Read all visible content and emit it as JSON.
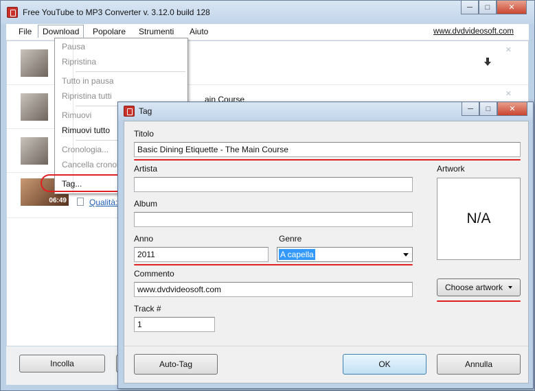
{
  "app": {
    "title": "Free YouTube to MP3 Converter  v. 3.12.0 build 128"
  },
  "menubar": {
    "items": [
      "File",
      "Download",
      "Popolare",
      "Strumenti",
      "Aiuto"
    ],
    "site_link": "www.dvdvideosoft.com"
  },
  "download_menu": {
    "items": [
      {
        "label": "Pausa",
        "enabled": false
      },
      {
        "label": "Ripristina",
        "enabled": false
      },
      {
        "label": "Tutto in pausa",
        "enabled": false
      },
      {
        "label": "Ripristina tutti",
        "enabled": false
      },
      {
        "label": "Rimuovi",
        "enabled": false
      },
      {
        "label": "Rimuovi tutto",
        "enabled": true
      },
      {
        "label": "Cronologia...",
        "enabled": false
      },
      {
        "label": "Cancella cronol",
        "enabled": false
      },
      {
        "label": "Tag...",
        "enabled": true
      }
    ]
  },
  "list": {
    "row2_title_fragment": "ain Course",
    "row4_duration": "06:49",
    "row4_quality_label": "Qualità:"
  },
  "bottom": {
    "paste_label": "Incolla"
  },
  "tag_dialog": {
    "title": "Tag",
    "fields": {
      "titolo": {
        "label": "Titolo",
        "value": "Basic Dining Etiquette - The Main Course"
      },
      "artista": {
        "label": "Artista",
        "value": ""
      },
      "album": {
        "label": "Album",
        "value": ""
      },
      "anno": {
        "label": "Anno",
        "value": "2011"
      },
      "genre": {
        "label": "Genre",
        "value": "A capella"
      },
      "commento": {
        "label": "Commento",
        "value": "www.dvdvideosoft.com"
      },
      "track": {
        "label": "Track #",
        "value": "1"
      }
    },
    "artwork": {
      "label": "Artwork",
      "placeholder": "N/A",
      "choose_label": "Choose artwork"
    },
    "buttons": {
      "autotag": "Auto-Tag",
      "ok": "OK",
      "cancel": "Annulla"
    }
  },
  "colors": {
    "highlight_red": "#e02020",
    "selection_blue": "#3399ff",
    "link_blue": "#1f5fb5"
  }
}
